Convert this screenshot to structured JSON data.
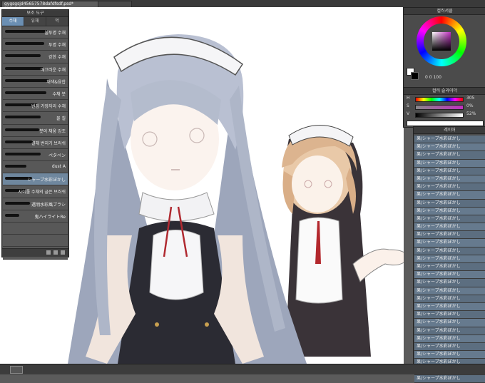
{
  "tabs": [
    {
      "label": "gygsgsjd45657578dafdfsdf.psd*",
      "active": true
    },
    {
      "label": "",
      "active": false
    }
  ],
  "brush_panel": {
    "title": "보조 도구",
    "tabs": [
      "수채",
      "유채",
      "먹"
    ],
    "items": [
      {
        "label": "불투명 수채",
        "stroke_width": 60,
        "selected": false
      },
      {
        "label": "투명 수채",
        "stroke_width": 55,
        "selected": false
      },
      {
        "label": "강한 수채",
        "stroke_width": 50,
        "selected": false
      },
      {
        "label": "매끄러운 수채",
        "stroke_width": 55,
        "selected": false
      },
      {
        "label": "채색&융합",
        "stroke_width": 62,
        "selected": false
      },
      {
        "label": "수채 붓",
        "stroke_width": 58,
        "selected": false
      },
      {
        "label": "번짐 가장자리 수채",
        "stroke_width": 45,
        "selected": false
      },
      {
        "label": "물 칠",
        "stroke_width": 50,
        "selected": false
      },
      {
        "label": "붓이 채움 강조",
        "stroke_width": 48,
        "selected": false
      },
      {
        "label": "결채 번지기 브러쉬",
        "stroke_width": 40,
        "selected": false
      },
      {
        "label": "ペタペン",
        "stroke_width": 50,
        "selected": false
      },
      {
        "label": "dust A",
        "stroke_width": 30,
        "selected": false
      },
      {
        "label": "シャープ水彩ぼかし",
        "stroke_width": 38,
        "selected": true
      },
      {
        "label": "사이툴 수채의 글은 브러쉬",
        "stroke_width": 30,
        "selected": false
      },
      {
        "label": "透明水彩風ブラシ",
        "stroke_width": 35,
        "selected": false
      },
      {
        "label": "鬼ハイライトRe",
        "stroke_width": 20,
        "selected": false
      },
      {
        "label": "",
        "stroke_width": 0,
        "selected": false
      },
      {
        "label": "",
        "stroke_width": 0,
        "selected": false
      },
      {
        "label": "",
        "stroke_width": 0,
        "selected": false
      }
    ]
  },
  "color_wheel": {
    "title": "컬러서클",
    "main_color": "#ffffff",
    "sub_color": "#000000",
    "readout": "0 0 100"
  },
  "color_slider": {
    "title": "컬러 슬라이더",
    "rows": [
      {
        "letter": "H",
        "value": "305"
      },
      {
        "letter": "S",
        "value": "0%"
      },
      {
        "letter": "V",
        "value": "52%"
      }
    ]
  },
  "layer_panel": {
    "title": "레이어",
    "rows": [
      "果/シャープ水彩ぼかし",
      "果/シャープ水彩ぼかし",
      "果/シャープ水彩ぼかし",
      "果/シャープ水彩ぼかし",
      "果/シャープ水彩ぼかし",
      "果/シャープ水彩ぼかし",
      "果/シャープ水彩ぼかし",
      "果/シャープ水彩ぼかし",
      "果/シャープ水彩ぼかし",
      "果/シャープ水彩ぼかし",
      "果/シャープ水彩ぼかし",
      "果/シャープ水彩ぼかし",
      "果/シャープ水彩ぼかし",
      "果/シャープ水彩ぼかし",
      "果/シャープ水彩ぼかし",
      "果/シャープ水彩ぼかし",
      "果/シャープ水彩ぼかし",
      "果/シャープ水彩ぼかし",
      "果/シャープ水彩ぼかし",
      "果/シャープ水彩ぼかし",
      "果/シャープ水彩ぼかし",
      "果/シャープ水彩ぼかし",
      "果/シャープ水彩ぼかし",
      "果/シャープ水彩ぼかし",
      "果/シャープ水彩ぼかし",
      "果/シャープ水彩ぼかし",
      "果/シャープ水彩ぼかし",
      "果/シャープ水彩ぼかし",
      "果/シャープ水彩ぼかし",
      "果/シャープ水彩ぼかし",
      "果/シャープ水彩ぼかし"
    ]
  },
  "colors": {
    "panel_bg": "#4e4e4e",
    "selected": "#6f879e",
    "layer_row": "#5c6e80",
    "canvas": "#ffffff"
  }
}
